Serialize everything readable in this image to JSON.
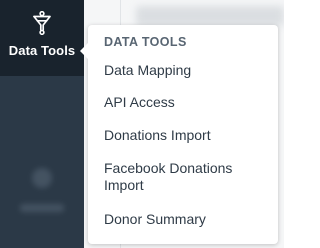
{
  "sidebar": {
    "active_item": {
      "label": "Data Tools",
      "icon": "funnel-icon"
    }
  },
  "menu": {
    "header": "DATA TOOLS",
    "items": [
      {
        "label": "Data Mapping"
      },
      {
        "label": "API Access"
      },
      {
        "label": "Donations Import"
      },
      {
        "label": "Facebook Donations Import"
      },
      {
        "label": "Donor Summary"
      }
    ]
  },
  "colors": {
    "sidebar_bg": "#2b3947",
    "sidebar_active_bg": "#19232d",
    "menu_text": "#2f3b47",
    "menu_header_text": "#586572"
  }
}
